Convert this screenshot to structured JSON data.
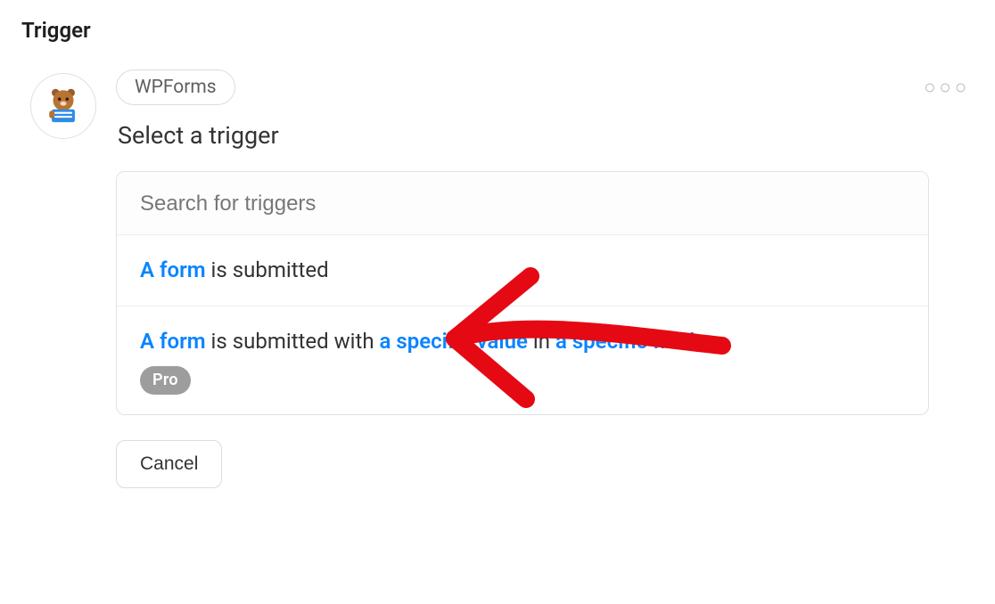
{
  "section_title": "Trigger",
  "integration": {
    "name": "WPForms"
  },
  "subtitle": "Select a trigger",
  "search": {
    "placeholder": "Search for triggers",
    "value": ""
  },
  "options": [
    {
      "parts": [
        {
          "text": "A form",
          "link": true
        },
        {
          "text": " is submitted",
          "link": false
        }
      ],
      "pro": false
    },
    {
      "parts": [
        {
          "text": "A form",
          "link": true
        },
        {
          "text": " is submitted with ",
          "link": false
        },
        {
          "text": "a specific value",
          "link": true
        },
        {
          "text": " in ",
          "link": false
        },
        {
          "text": "a specific field",
          "link": true
        }
      ],
      "pro": true
    }
  ],
  "pro_label": "Pro",
  "cancel_label": "Cancel",
  "more_glyph": "○○○",
  "colors": {
    "link": "#0a84ff",
    "arrow": "#e50914",
    "badge": "#9d9d9d"
  }
}
